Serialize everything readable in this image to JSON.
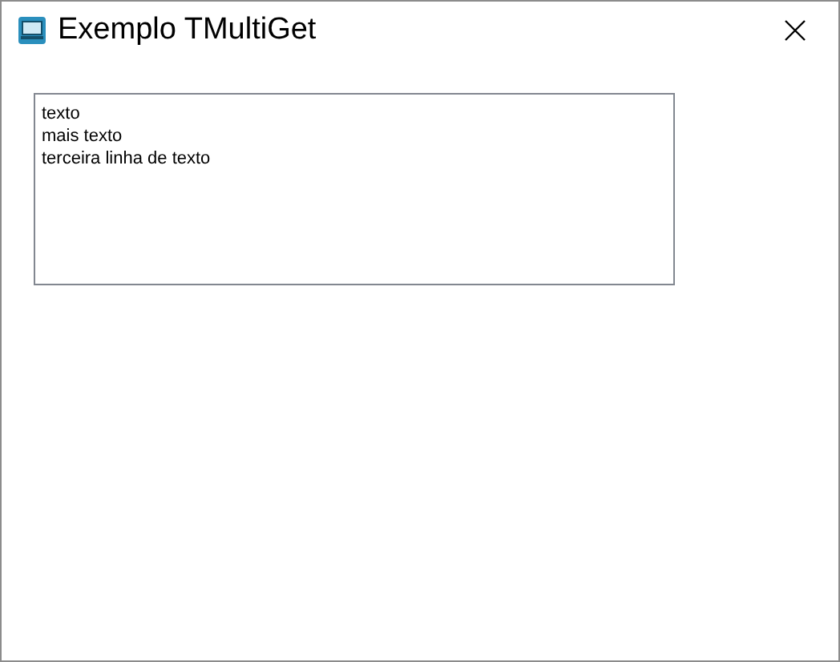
{
  "window": {
    "title": "Exemplo TMultiGet"
  },
  "memo": {
    "lines": [
      "texto",
      "mais texto",
      "terceira linha de texto"
    ]
  }
}
